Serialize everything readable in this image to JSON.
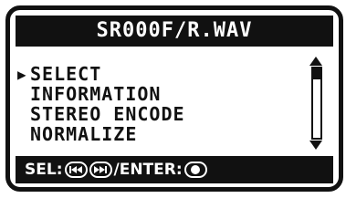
{
  "screen": {
    "title": "SR000F/R.WAV"
  },
  "menu": {
    "selected_index": 0,
    "items": [
      {
        "label": "SELECT"
      },
      {
        "label": "INFORMATION"
      },
      {
        "label": "STEREO ENCODE"
      },
      {
        "label": "NORMALIZE"
      }
    ]
  },
  "scrollbar": {
    "position_fraction": 0.0
  },
  "footer": {
    "select_label": "SEL:",
    "enter_label": "/ENTER:",
    "icons": [
      "rewind-icon",
      "fast-forward-icon",
      "record-icon"
    ]
  },
  "colors": {
    "background": "#ffffff",
    "foreground": "#111111"
  }
}
